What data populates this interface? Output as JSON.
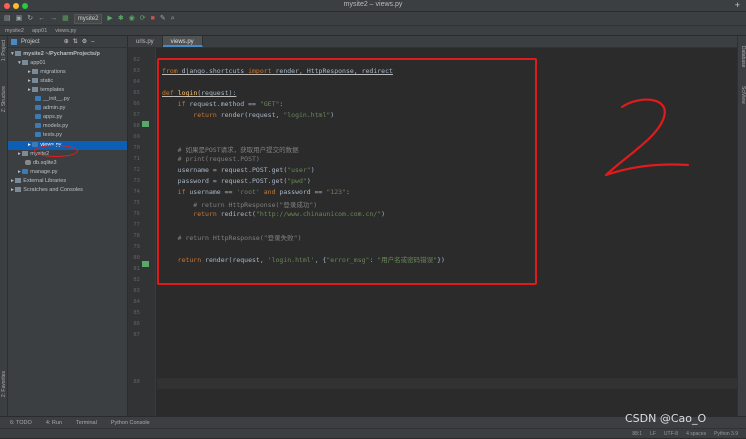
{
  "window": {
    "title": "mysite2 – views.py"
  },
  "toolbar": {
    "run_config": "mysite2"
  },
  "breadcrumb": [
    "mysite2",
    "app01",
    "views.py"
  ],
  "left_strip": [
    "1: Project",
    "Z: Structure",
    "2: Favorites"
  ],
  "right_strip": [
    "Database",
    "SciView"
  ],
  "project_panel": {
    "title": "Project",
    "items": [
      "mysite2 ~/PycharmProjects/p",
      "app01",
      "migrations",
      "static",
      "templates",
      "__init__.py",
      "admin.py",
      "apps.py",
      "models.py",
      "tests.py",
      "views.py",
      "mysite2",
      "db.sqlite3",
      "manage.py",
      "External Libraries",
      "Scratches and Consoles"
    ]
  },
  "tabs": [
    "urls.py",
    "views.py"
  ],
  "editor": {
    "line_numbers": [
      "62",
      "63",
      "64",
      "65",
      "66",
      "67",
      "68",
      "69",
      "70",
      "71",
      "72",
      "73",
      "74",
      "75",
      "76",
      "77",
      "78",
      "79",
      "80",
      "81",
      "82",
      "83",
      "84",
      "85",
      "86",
      "87",
      "88"
    ],
    "code": {
      "l63a": "from",
      "l63b": " django.shortcuts ",
      "l63c": "import",
      "l63d": " render, HttpResponse, redirect",
      "l65a": "def",
      "l65b": " login",
      "l65c": "(request):",
      "l66a": "    if",
      "l66b": " request.method == ",
      "l66c": "\"GET\"",
      "l66d": ":",
      "l67a": "        return",
      "l67b": " render(request, ",
      "l67c": "\"login.html\"",
      "l67d": ")",
      "l69": "    # 如果是POST请求，获取用户提交的数据",
      "l70": "    # print(request.POST)",
      "l71a": "    username = request.POST.get(",
      "l71b": "\"user\"",
      "l71c": ")",
      "l72a": "    password = request.POST.get(",
      "l72b": "\"pwd\"",
      "l72c": ")",
      "l73a": "    if",
      "l73b": " username == ",
      "l73c": "'root'",
      "l73d": " and",
      "l73e": " password == ",
      "l73f": "\"123\"",
      "l73g": ":",
      "l74": "        # return HttpResponse(\"登录成功\")",
      "l75a": "        return",
      "l75b": " redirect(",
      "l75c": "\"http://www.chinaunicom.com.cn/\"",
      "l75d": ")",
      "l77": "    # return HttpResponse(\"登录失败\")",
      "l78a": "    return",
      "l78b": " render(request, ",
      "l78c": "'login.html'",
      "l78d": ", {",
      "l78e": "\"error_msg\"",
      "l78f": ": ",
      "l78g": "\"用户名或密码错误\"",
      "l78h": "})"
    }
  },
  "bottom_tools": [
    "6: TODO",
    "4: Run",
    "Terminal",
    "Python Console"
  ],
  "status": {
    "position": "88:1",
    "line_sep": "LF",
    "encoding": "UTF-8",
    "indent": "4 spaces",
    "interpreter": "Python 3.9"
  },
  "watermark": "CSDN @Cao_O",
  "colors": {
    "annotation_red": "#e01b1b",
    "selection_blue": "#0d5fb5"
  }
}
